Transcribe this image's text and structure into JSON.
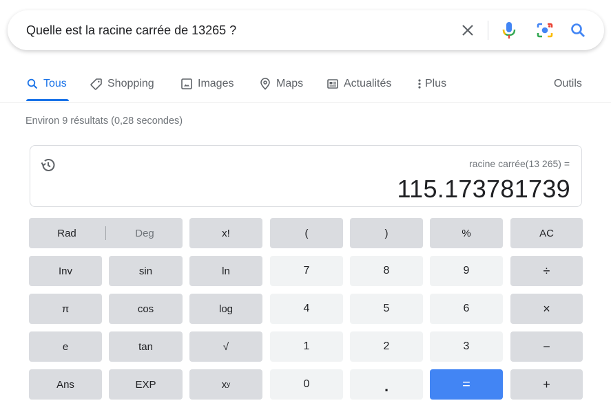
{
  "search": {
    "query": "Quelle est la racine carrée de 13265 ?"
  },
  "tabs": {
    "items": [
      {
        "label": "Tous"
      },
      {
        "label": "Shopping"
      },
      {
        "label": "Images"
      },
      {
        "label": "Maps"
      },
      {
        "label": "Actualités"
      },
      {
        "label": "Plus"
      }
    ],
    "tools": "Outils"
  },
  "stats": "Environ 9 résultats (0,28 secondes)",
  "calculator": {
    "expression": "racine carrée(13 265) =",
    "result": "115.173781739",
    "keys": {
      "rad": "Rad",
      "deg": "Deg",
      "fact": "x!",
      "lparen": "(",
      "rparen": ")",
      "percent": "%",
      "ac": "AC",
      "inv": "Inv",
      "sin": "sin",
      "ln": "ln",
      "k7": "7",
      "k8": "8",
      "k9": "9",
      "divide": "÷",
      "pi": "π",
      "cos": "cos",
      "log": "log",
      "k4": "4",
      "k5": "5",
      "k6": "6",
      "multiply": "×",
      "e": "e",
      "tan": "tan",
      "sqrt": "√",
      "k1": "1",
      "k2": "2",
      "k3": "3",
      "minus": "−",
      "ans": "Ans",
      "exp": "EXP",
      "pow_base": "x",
      "pow_exp": "y",
      "k0": "0",
      "dot": ".",
      "equals": "=",
      "plus": "+"
    }
  },
  "colors": {
    "accent": "#1a73e8",
    "equals_key": "#4285f4",
    "function_key": "#dadce0",
    "number_key": "#f1f3f4"
  }
}
